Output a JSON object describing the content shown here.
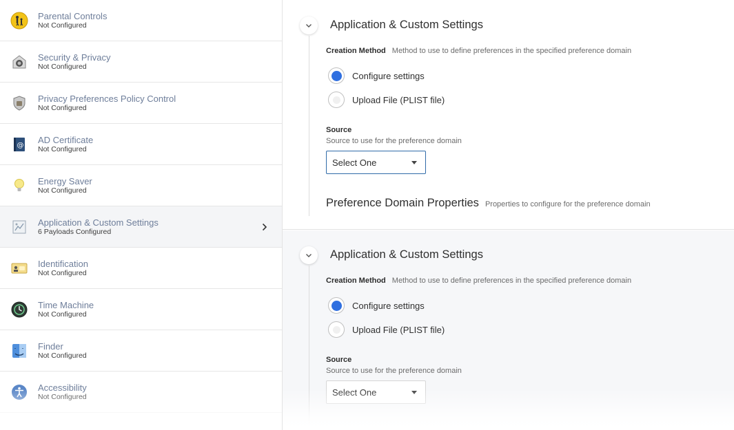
{
  "sidebar": {
    "items": [
      {
        "title": "Parental Controls",
        "status": "Not Configured",
        "icon": "parental-controls-icon"
      },
      {
        "title": "Security & Privacy",
        "status": "Not Configured",
        "icon": "security-privacy-icon"
      },
      {
        "title": "Privacy Preferences Policy Control",
        "status": "Not Configured",
        "icon": "privacy-shield-icon"
      },
      {
        "title": "AD Certificate",
        "status": "Not Configured",
        "icon": "ad-certificate-icon"
      },
      {
        "title": "Energy Saver",
        "status": "Not Configured",
        "icon": "lightbulb-icon"
      },
      {
        "title": "Application & Custom Settings",
        "status": "6 Payloads Configured",
        "icon": "custom-settings-icon"
      },
      {
        "title": "Identification",
        "status": "Not Configured",
        "icon": "id-card-icon"
      },
      {
        "title": "Time Machine",
        "status": "Not Configured",
        "icon": "time-machine-icon"
      },
      {
        "title": "Finder",
        "status": "Not Configured",
        "icon": "finder-icon"
      },
      {
        "title": "Accessibility",
        "status": "Not Configured",
        "icon": "accessibility-icon"
      }
    ]
  },
  "panels": [
    {
      "title": "Application & Custom Settings",
      "creation_method_label": "Creation Method",
      "creation_method_desc": "Method to use to define preferences in the specified preference domain",
      "option_configure": "Configure settings",
      "option_upload": "Upload File (PLIST file)",
      "selected_option": "Configure settings",
      "source_label": "Source",
      "source_desc": "Source to use for the preference domain",
      "source_value": "Select One",
      "pref_domain_title": "Preference Domain Properties",
      "pref_domain_desc": "Properties to configure for the preference domain"
    },
    {
      "title": "Application & Custom Settings",
      "creation_method_label": "Creation Method",
      "creation_method_desc": "Method to use to define preferences in the specified preference domain",
      "option_configure": "Configure settings",
      "option_upload": "Upload File (PLIST file)",
      "selected_option": "Configure settings",
      "source_label": "Source",
      "source_desc": "Source to use for the preference domain",
      "source_value": "Select One"
    }
  ],
  "colors": {
    "accent": "#2f6fe0",
    "sidebar_title": "#6e7e9a",
    "active_item_bg": "#f4f5f7"
  }
}
